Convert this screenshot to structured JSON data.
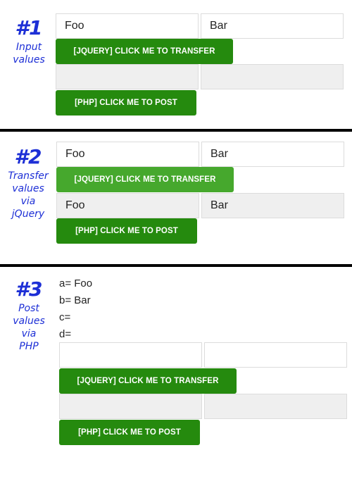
{
  "sections": [
    {
      "number": "#1",
      "caption": [
        "Input",
        "values"
      ],
      "inputs": {
        "a": "Foo",
        "b": "Bar",
        "c": "",
        "d": ""
      },
      "jquery_button": "[JQUERY] CLICK ME TO TRANSFER",
      "php_button": "[PHP] CLICK ME TO POST"
    },
    {
      "number": "#2",
      "caption": [
        "Transfer",
        "values",
        "via",
        "jQuery"
      ],
      "inputs": {
        "a": "Foo",
        "b": "Bar",
        "c": "Foo",
        "d": "Bar"
      },
      "jquery_button": "[JQUERY] CLICK ME TO TRANSFER",
      "php_button": "[PHP] CLICK ME TO POST"
    },
    {
      "number": "#3",
      "caption": [
        "Post",
        "values",
        "via",
        "PHP"
      ],
      "output_lines": [
        "a= Foo",
        "b= Bar",
        "c=",
        "d="
      ],
      "inputs": {
        "a": "",
        "b": "",
        "c": "",
        "d": ""
      },
      "jquery_button": "[JQUERY] CLICK ME TO TRANSFER",
      "php_button": "[PHP] CLICK ME TO POST"
    }
  ],
  "colors": {
    "label": "#1d2fd6",
    "button": "#258a0e",
    "button_hover": "#46a82d",
    "filled_input": "#efefef"
  }
}
